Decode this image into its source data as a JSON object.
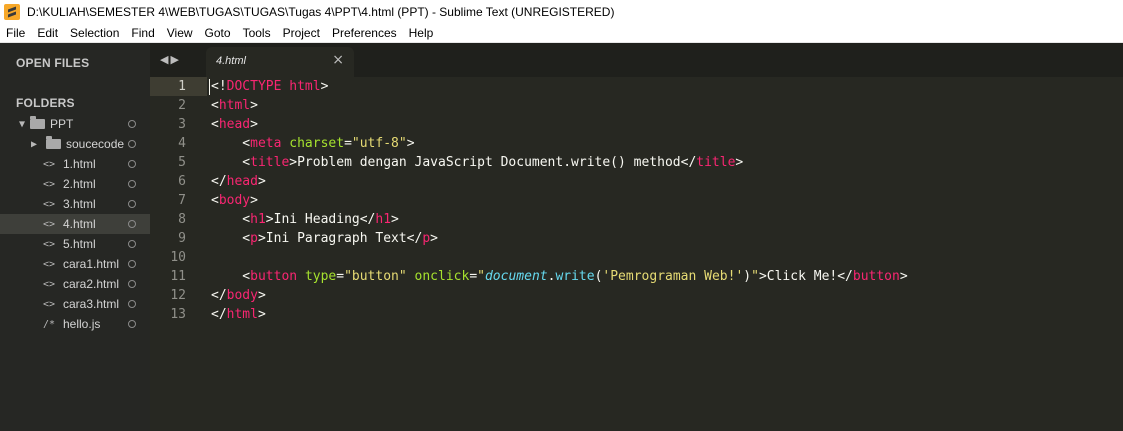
{
  "window": {
    "title": "D:\\KULIAH\\SEMESTER 4\\WEB\\TUGAS\\TUGAS\\Tugas 4\\PPT\\4.html (PPT) - Sublime Text (UNREGISTERED)"
  },
  "menu": [
    "File",
    "Edit",
    "Selection",
    "Find",
    "View",
    "Goto",
    "Tools",
    "Project",
    "Preferences",
    "Help"
  ],
  "sidebar": {
    "open_files_label": "OPEN FILES",
    "folders_label": "FOLDERS",
    "root_folder": "PPT",
    "items": [
      {
        "label": "soucecode",
        "kind": "folder"
      },
      {
        "label": "1.html",
        "kind": "html"
      },
      {
        "label": "2.html",
        "kind": "html"
      },
      {
        "label": "3.html",
        "kind": "html"
      },
      {
        "label": "4.html",
        "kind": "html",
        "active": true
      },
      {
        "label": "5.html",
        "kind": "html"
      },
      {
        "label": "cara1.html",
        "kind": "html"
      },
      {
        "label": "cara2.html",
        "kind": "html"
      },
      {
        "label": "cara3.html",
        "kind": "html"
      },
      {
        "label": "hello.js",
        "kind": "js"
      }
    ]
  },
  "tab": {
    "label": "4.html",
    "close": "×"
  },
  "editor": {
    "line_numbers": [
      "1",
      "2",
      "3",
      "4",
      "5",
      "6",
      "7",
      "8",
      "9",
      "10",
      "11",
      "12",
      "13"
    ],
    "lines": [
      [
        [
          "pl",
          "<!"
        ],
        [
          "tg",
          "DOCTYPE"
        ],
        [
          "pl",
          " "
        ],
        [
          "tg",
          "html"
        ],
        [
          "pl",
          ">"
        ]
      ],
      [
        [
          "pl",
          "<"
        ],
        [
          "tg",
          "html"
        ],
        [
          "pl",
          ">"
        ]
      ],
      [
        [
          "pl",
          "<"
        ],
        [
          "tg",
          "head"
        ],
        [
          "pl",
          ">"
        ]
      ],
      [
        [
          "pl",
          "    <"
        ],
        [
          "tg",
          "meta"
        ],
        [
          "pl",
          " "
        ],
        [
          "at",
          "charset"
        ],
        [
          "pl",
          "="
        ],
        [
          "st",
          "\"utf-8\""
        ],
        [
          "pl",
          ">"
        ]
      ],
      [
        [
          "pl",
          "    <"
        ],
        [
          "tg",
          "title"
        ],
        [
          "pl",
          ">Problem dengan JavaScript Document.write() method</"
        ],
        [
          "tg",
          "title"
        ],
        [
          "pl",
          ">"
        ]
      ],
      [
        [
          "pl",
          "</"
        ],
        [
          "tg",
          "head"
        ],
        [
          "pl",
          ">"
        ]
      ],
      [
        [
          "pl",
          "<"
        ],
        [
          "tg",
          "body"
        ],
        [
          "pl",
          ">"
        ]
      ],
      [
        [
          "pl",
          "    <"
        ],
        [
          "tg",
          "h1"
        ],
        [
          "pl",
          ">Ini Heading</"
        ],
        [
          "tg",
          "h1"
        ],
        [
          "pl",
          ">"
        ]
      ],
      [
        [
          "pl",
          "    <"
        ],
        [
          "tg",
          "p"
        ],
        [
          "pl",
          ">Ini Paragraph Text</"
        ],
        [
          "tg",
          "p"
        ],
        [
          "pl",
          ">"
        ]
      ],
      [],
      [
        [
          "pl",
          "    <"
        ],
        [
          "tg",
          "button"
        ],
        [
          "pl",
          " "
        ],
        [
          "at",
          "type"
        ],
        [
          "pl",
          "="
        ],
        [
          "st",
          "\"button\""
        ],
        [
          "pl",
          " "
        ],
        [
          "at",
          "onclick"
        ],
        [
          "pl",
          "="
        ],
        [
          "st",
          "\""
        ],
        [
          "js",
          "document"
        ],
        [
          "pl",
          "."
        ],
        [
          "fn",
          "write"
        ],
        [
          "pl",
          "("
        ],
        [
          "st",
          "'Pemrograman Web!'"
        ],
        [
          "pl",
          ")"
        ],
        [
          "st",
          "\""
        ],
        [
          "pl",
          ">Click Me!</"
        ],
        [
          "tg",
          "button"
        ],
        [
          "pl",
          ">"
        ]
      ],
      [
        [
          "pl",
          "</"
        ],
        [
          "tg",
          "body"
        ],
        [
          "pl",
          ">"
        ]
      ],
      [
        [
          "pl",
          "</"
        ],
        [
          "tg",
          "html"
        ],
        [
          "pl",
          ">"
        ]
      ]
    ]
  },
  "colors": {
    "background": "#272822",
    "tag": "#f92672",
    "attribute": "#a6e22e",
    "string": "#e6db74",
    "js": "#66d9ef"
  }
}
